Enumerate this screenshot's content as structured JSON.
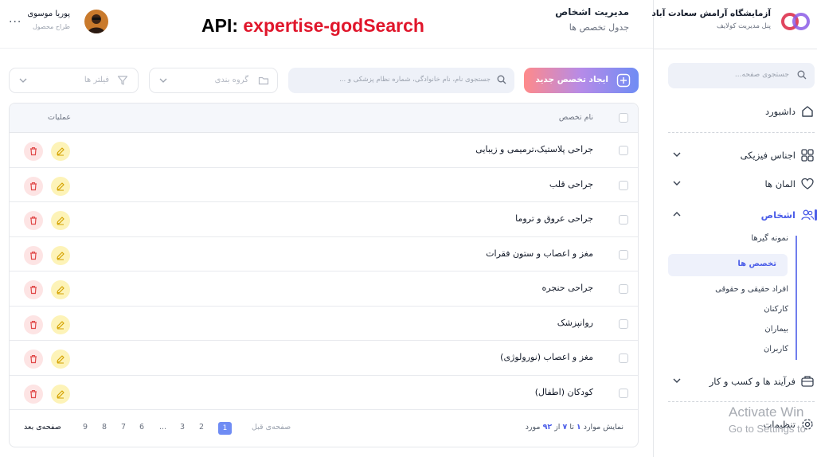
{
  "brand": {
    "title": "آزمایشگاه آرامش سعادت آباد",
    "subtitle": "پنل مدیریت کولایف"
  },
  "sidebar": {
    "search_placeholder": "جستجوی صفحه...",
    "items": [
      {
        "label": "داشبورد",
        "icon": "home-icon"
      },
      {
        "label": "اجناس فیزیکی",
        "icon": "grid-icon"
      },
      {
        "label": "المان ها",
        "icon": "heart-icon"
      },
      {
        "label": "اشخاص",
        "icon": "users-icon"
      },
      {
        "label": "فرآیند ها و کسب و کار",
        "icon": "briefcase-icon"
      },
      {
        "label": "تنظیمات",
        "icon": "gear-icon"
      }
    ],
    "subitems": [
      "نمونه گیرها",
      "تخصص ها",
      "افراد حقیقی و حقوقی",
      "کارکنان",
      "بیماران",
      "کاربران"
    ]
  },
  "header": {
    "title": "مدیریت اشخاص",
    "subtitle": "جدول تخصص ها",
    "api_label": "API:",
    "api_value": "expertise-godSearch",
    "user_name": "پوریا موسوی",
    "user_role": "طراح محصول",
    "more": "..."
  },
  "toolbar": {
    "create_label": "ایجاد تخصص جدید",
    "search_placeholder": "جستجوی نام، نام خانوادگی، شماره نظام پزشکی و ...",
    "group_label": "گروه بندی",
    "filter_label": "فیلتر ها"
  },
  "table": {
    "columns": {
      "name": "نام تخصص",
      "ops": "عملیات"
    },
    "rows": [
      "جراحی پلاستیک،ترمیمی و زیبایی",
      "جراحی قلب",
      "جراحی عروق و تروما",
      "مغز و اعصاب و ستون فقرات",
      "جراحی حنجره",
      "روانپزشک",
      "مغز و اعصاب (نورولوژی)",
      "کودکان (اطفال)"
    ]
  },
  "footer": {
    "count_prefix": "نمایش موارد",
    "count_from": "۱",
    "count_to_word": "تا",
    "count_to": "۷",
    "count_of_word": "از",
    "count_total": "۹۲",
    "count_suffix": "مورد",
    "prev": "صفحه‌ی قبل",
    "next": "صفحه‌ی بعد",
    "pages": [
      "1",
      "2",
      "3",
      "...",
      "6",
      "7",
      "8",
      "9"
    ]
  },
  "watermark": {
    "line1": "Activate Win",
    "line2": "Go to Settings to"
  },
  "colors": {
    "accent": "#4c5ee8",
    "delete_bg": "#fde4e4",
    "edit_bg": "#fdf3b8"
  }
}
